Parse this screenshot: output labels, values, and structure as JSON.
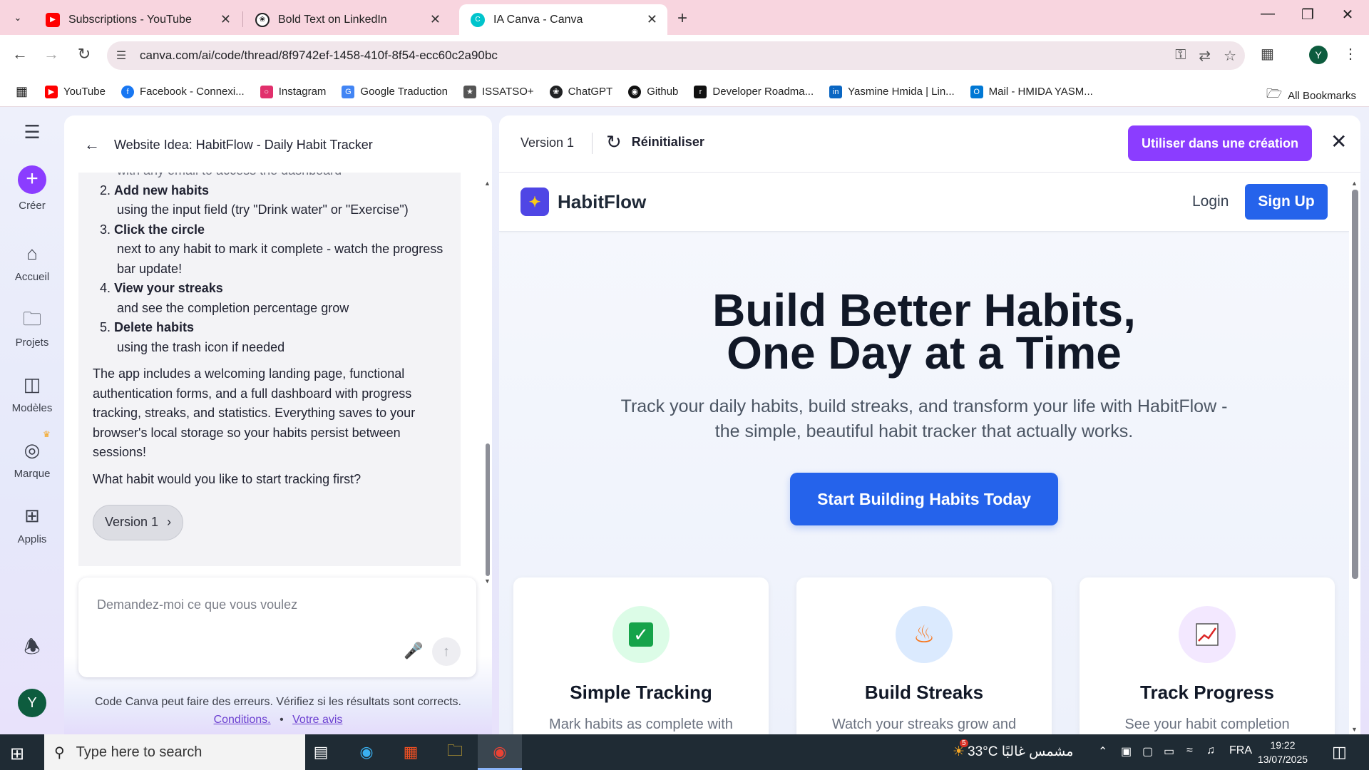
{
  "browser": {
    "tabs": [
      {
        "title": "Subscriptions - YouTube",
        "icon": "youtube-icon",
        "color": "#ff0000"
      },
      {
        "title": "Bold Text on LinkedIn",
        "icon": "chatgpt-icon",
        "color": "#202123"
      },
      {
        "title": "IA Canva - Canva",
        "icon": "canva-icon",
        "color": "#00c4cc"
      }
    ],
    "url": "canva.com/ai/code/thread/8f9742ef-1458-410f-8f54-ecc60c2a90bc",
    "profile_initial": "Y",
    "bookmarks": [
      "YouTube",
      "Facebook - Connexi...",
      "Instagram",
      "Google Traduction",
      "ISSATSO+",
      "ChatGPT",
      "Github",
      "Developer Roadma...",
      "Yasmine Hmida | Lin...",
      "Mail - HMIDA YASM..."
    ],
    "all_bookmarks": "All Bookmarks"
  },
  "sidebar": {
    "create": "Créer",
    "items": [
      "Accueil",
      "Projets",
      "Modèles",
      "Marque",
      "Applis"
    ],
    "avatar": "Y"
  },
  "chat": {
    "title": "Website Idea: HabitFlow - Daily Habit Tracker",
    "faded_line": "with any email to access the dashboard",
    "steps": [
      {
        "bold": "Add new habits",
        "text": "using the input field (try \"Drink water\" or \"Exercise\")"
      },
      {
        "bold": "Click the circle",
        "text": "next to any habit to mark it complete - watch the progress bar update!"
      },
      {
        "bold": "View your streaks",
        "text": "and see the completion percentage grow"
      },
      {
        "bold": "Delete habits",
        "text": "using the trash icon if needed"
      }
    ],
    "paragraph": "The app includes a welcoming landing page, functional authentication forms, and a full dashboard with progress tracking, streaks, and statistics. Everything saves to your browser's local storage so your habits persist between sessions!",
    "question": "What habit would you like to start tracking first?",
    "version_pill": "Version 1",
    "input_placeholder": "Demandez-moi ce que vous voulez",
    "disclaimer": "Code Canva peut faire des erreurs. Vérifiez si les résultats sont corrects.",
    "link_conditions": "Conditions.",
    "link_separator": "•",
    "link_feedback": "Votre avis"
  },
  "preview": {
    "version": "Version 1",
    "reset": "Réinitialiser",
    "use_button": "Utiliser dans une création",
    "site": {
      "brand": "HabitFlow",
      "login": "Login",
      "signup": "Sign Up",
      "hero_line1": "Build Better Habits,",
      "hero_line2": "One Day at a Time",
      "subtitle": "Track your daily habits, build streaks, and transform your life with HabitFlow - the simple, beautiful habit tracker that actually works.",
      "cta": "Start Building Habits Today",
      "features": [
        {
          "title": "Simple Tracking",
          "desc": "Mark habits as complete with",
          "icon": "check-icon",
          "bg": "#dcfce7"
        },
        {
          "title": "Build Streaks",
          "desc": "Watch your streaks grow and",
          "icon": "fire-icon",
          "bg": "#dbeafe"
        },
        {
          "title": "Track Progress",
          "desc": "See your habit completion",
          "icon": "chart-icon",
          "bg": "#f3e8ff"
        }
      ]
    }
  },
  "taskbar": {
    "search_placeholder": "Type here to search",
    "weather": "33°C  مشمس غالبًا",
    "weather_badge": "5",
    "lang": "FRA",
    "time": "19:22",
    "date": "13/07/2025"
  }
}
